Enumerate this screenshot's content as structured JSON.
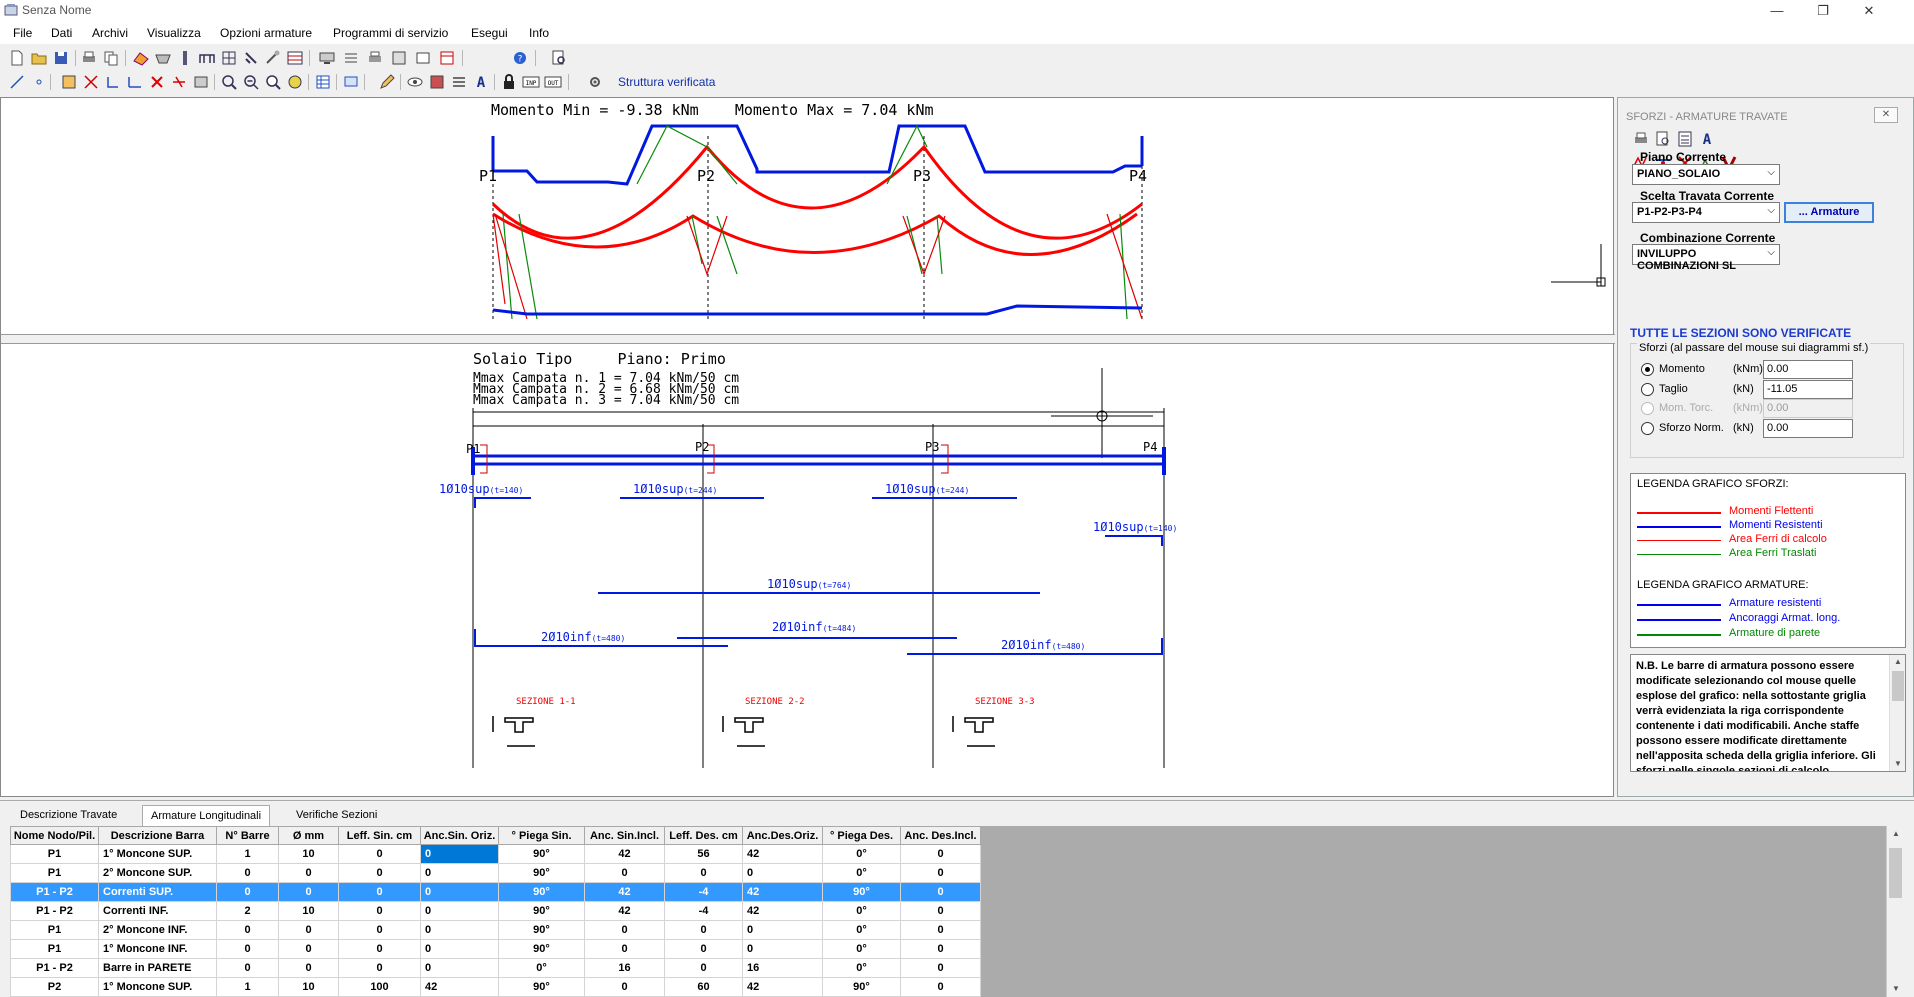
{
  "window": {
    "title": "Senza Nome",
    "minimize": "—",
    "restore": "❐",
    "close": "✕"
  },
  "menu": [
    "File",
    "Dati",
    "Archivi",
    "Visualizza",
    "Opzioni armature",
    "Programmi di servizio",
    "Esegui",
    "Info"
  ],
  "toolbar": {
    "status": "Struttura verificata"
  },
  "diagram_top": {
    "header": "Momento Min = -9.38 kNm    Momento Max = 7.04 kNm",
    "nodes": [
      "P1",
      "P2",
      "P3",
      "P4"
    ]
  },
  "diagram_bottom": {
    "header": "Solaio Tipo     Piano: Primo",
    "mmax": [
      "Mmax Campata n. 1 = 7.04 kNm/50 cm",
      "Mmax Campata n. 2 = 6.68 kNm/50 cm",
      "Mmax Campata n. 3 = 7.04 kNm/50 cm"
    ],
    "nodes": [
      "P1",
      "P2",
      "P3",
      "P4"
    ],
    "bar_labels": {
      "sup1": "1Ø10sup",
      "sup1_t": "(t=140)",
      "sup2": "1Ø10sup",
      "sup2_t": "(t=244)",
      "sup3": "1Ø10sup",
      "sup3_t": "(t=244)",
      "sup4": "1Ø10sup",
      "sup4_t": "(t=140)",
      "sup5": "1Ø10sup",
      "sup5_t": "(t=764)",
      "inf1": "2Ø10inf",
      "inf1_t": "(t=480)",
      "inf2": "2Ø10inf",
      "inf2_t": "(t=484)",
      "inf3": "2Ø10inf",
      "inf3_t": "(t=480)"
    },
    "sections": [
      "SEZIONE 1-1",
      "SEZIONE 2-2",
      "SEZIONE 3-3"
    ]
  },
  "panel": {
    "title": "SFORZI - ARMATURE TRAVATE",
    "close": "✕",
    "piano_label": "Piano Corrente",
    "piano_value": "PIANO_SOLAIO",
    "travata_label": "Scelta Travata Corrente",
    "travata_value": "P1-P2-P3-P4",
    "armature_button": "... Armature",
    "combinazione_label": "Combinazione Corrente",
    "combinazione_value": "INVILUPPO COMBINAZIONI  SL",
    "verified": "TUTTE LE SEZIONI SONO VERIFICATE",
    "sforzi_title": "Sforzi  (al passare del mouse sui diagrammi sf.)",
    "sforzi": [
      {
        "label": "Momento",
        "unit": "(kNm)",
        "value": "0.00",
        "checked": true,
        "disabled": false
      },
      {
        "label": "Taglio",
        "unit": "(kN)",
        "value": "-11.05",
        "checked": false,
        "disabled": false
      },
      {
        "label": "Mom. Torc.",
        "unit": "(kNm)",
        "value": "0.00",
        "checked": false,
        "disabled": true
      },
      {
        "label": "Sforzo Norm.",
        "unit": "(kN)",
        "value": "0.00",
        "checked": false,
        "disabled": false
      }
    ],
    "legend_sforzi_title": "LEGENDA GRAFICO SFORZI:",
    "legend_sforzi": [
      {
        "text": "Momenti Flettenti",
        "color": "#ff0000"
      },
      {
        "text": "Momenti Resistenti",
        "color": "#0000ee"
      },
      {
        "text": "Area Ferri di calcolo",
        "color": "#ff0000"
      },
      {
        "text": "Area Ferri Traslati",
        "color": "#008800"
      }
    ],
    "legend_armature_title": "LEGENDA GRAFICO ARMATURE:",
    "legend_armature": [
      {
        "text": "Armature resistenti",
        "color": "#0000ee"
      },
      {
        "text": "Ancoraggi Armat. long.",
        "color": "#0000ee"
      },
      {
        "text": "Armature di parete",
        "color": "#008800"
      }
    ],
    "note": "N.B. Le barre di armatura possono essere modificate selezionando col mouse quelle esplose del grafico: nella sottostante griglia verrà evidenziata la riga corrispondente contenente i dati modificabili. Anche staffe possono essere modificate direttamente nell'apposita scheda della griglia inferiore. Gli sforzi nelle singole sezioni di calcolo"
  },
  "tabs": [
    "Descrizione Travate",
    "Armature Longitudinali",
    "Verifiche Sezioni"
  ],
  "grid": {
    "columns": [
      "Nome Nodo/Pil.",
      "Descrizione Barra",
      "N° Barre",
      "Ø  mm",
      "Leff. Sin. cm",
      "Anc.Sin. Oriz.",
      "° Piega Sin.",
      "Anc. Sin.Incl.",
      "Leff. Des. cm",
      "Anc.Des.Oriz.",
      "° Piega Des.",
      "Anc. Des.Incl."
    ],
    "rows": [
      [
        "P1",
        "1° Moncone SUP.",
        "1",
        "10",
        "0",
        "0",
        "90°",
        "42",
        "56",
        "42",
        "0°",
        "0"
      ],
      [
        "P1",
        "2° Moncone SUP.",
        "0",
        "0",
        "0",
        "0",
        "90°",
        "0",
        "0",
        "0",
        "0°",
        "0"
      ],
      [
        "P1 - P2",
        "Correnti SUP.",
        "0",
        "0",
        "0",
        "0",
        "90°",
        "42",
        "-4",
        "42",
        "90°",
        "0"
      ],
      [
        "P1 - P2",
        "Correnti  INF.",
        "2",
        "10",
        "0",
        "0",
        "90°",
        "42",
        "-4",
        "42",
        "0°",
        "0"
      ],
      [
        "P1",
        "2° Moncone  INF.",
        "0",
        "0",
        "0",
        "0",
        "90°",
        "0",
        "0",
        "0",
        "0°",
        "0"
      ],
      [
        "P1",
        "1° Moncone  INF.",
        "0",
        "0",
        "0",
        "0",
        "90°",
        "0",
        "0",
        "0",
        "0°",
        "0"
      ],
      [
        "P1 - P2",
        "Barre in PARETE",
        "0",
        "0",
        "0",
        "0",
        "0°",
        "16",
        "0",
        "16",
        "0°",
        "0"
      ],
      [
        "P2",
        "1° Moncone SUP.",
        "1",
        "10",
        "100",
        "42",
        "90°",
        "0",
        "60",
        "42",
        "90°",
        "0"
      ]
    ]
  }
}
